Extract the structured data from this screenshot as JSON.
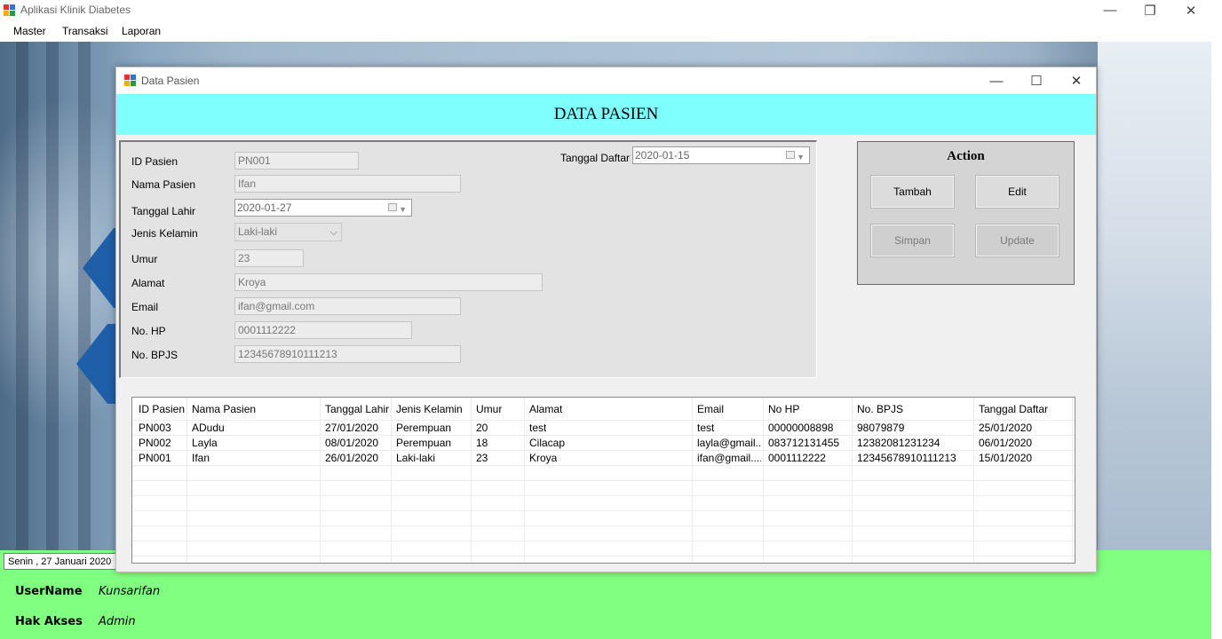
{
  "app": {
    "title": "Aplikasi Klinik Diabetes",
    "minimize": "—",
    "restore": "❐",
    "close": "✕"
  },
  "menu": [
    "Master",
    "Transaksi",
    "Laporan"
  ],
  "status": {
    "date_text": "Senin , 27   Januari   2020",
    "username_label": "UserName",
    "username_value": "Kunsarifan",
    "access_label": "Hak Akses",
    "access_value": "Admin"
  },
  "form": {
    "title": "Data Pasien",
    "header": "DATA PASIEN",
    "minimize": "—",
    "maximize": "☐",
    "close": "✕",
    "fields": {
      "id_label": "ID Pasien",
      "id_value": "PN001",
      "nama_label": "Nama Pasien",
      "nama_value": "Ifan",
      "tgl_lahir_label": "Tanggal Lahir",
      "tgl_lahir_value": "2020-01-27",
      "kelamin_label": "Jenis Kelamin",
      "kelamin_value": "Laki-laki",
      "umur_label": "Umur",
      "umur_value": "23",
      "alamat_label": "Alamat",
      "alamat_value": "Kroya",
      "email_label": "Email",
      "email_value": "ifan@gmail.com",
      "hp_label": "No. HP",
      "hp_value": "0001112222",
      "bpjs_label": "No. BPJS",
      "bpjs_value": "12345678910111213",
      "tgl_daftar_label": "Tanggal Daftar",
      "tgl_daftar_value": "2020-01-15"
    },
    "action": {
      "title": "Action",
      "tambah": "Tambah",
      "edit": "Edit",
      "simpan": "Simpan",
      "update": "Update"
    },
    "grid": {
      "columns": [
        "ID Pasien",
        "Nama Pasien",
        "Tanggal Lahir",
        "Jenis Kelamin",
        "Umur",
        "Alamat",
        "Email",
        "No HP",
        "No. BPJS",
        "Tanggal Daftar"
      ],
      "rows": [
        [
          "PN003",
          "ADudu",
          "27/01/2020",
          "Perempuan",
          "20",
          "test",
          "test",
          "00000008898",
          "98079879",
          "25/01/2020"
        ],
        [
          "PN002",
          "Layla",
          "08/01/2020",
          "Perempuan",
          "18",
          "Cilacap",
          "layla@gmail....",
          "083712131455",
          "12382081231234",
          "06/01/2020"
        ],
        [
          "PN001",
          "Ifan",
          "26/01/2020",
          "Laki-laki",
          "23",
          "Kroya",
          "ifan@gmail....",
          "0001112222",
          "12345678910111213",
          "15/01/2020"
        ]
      ]
    }
  }
}
